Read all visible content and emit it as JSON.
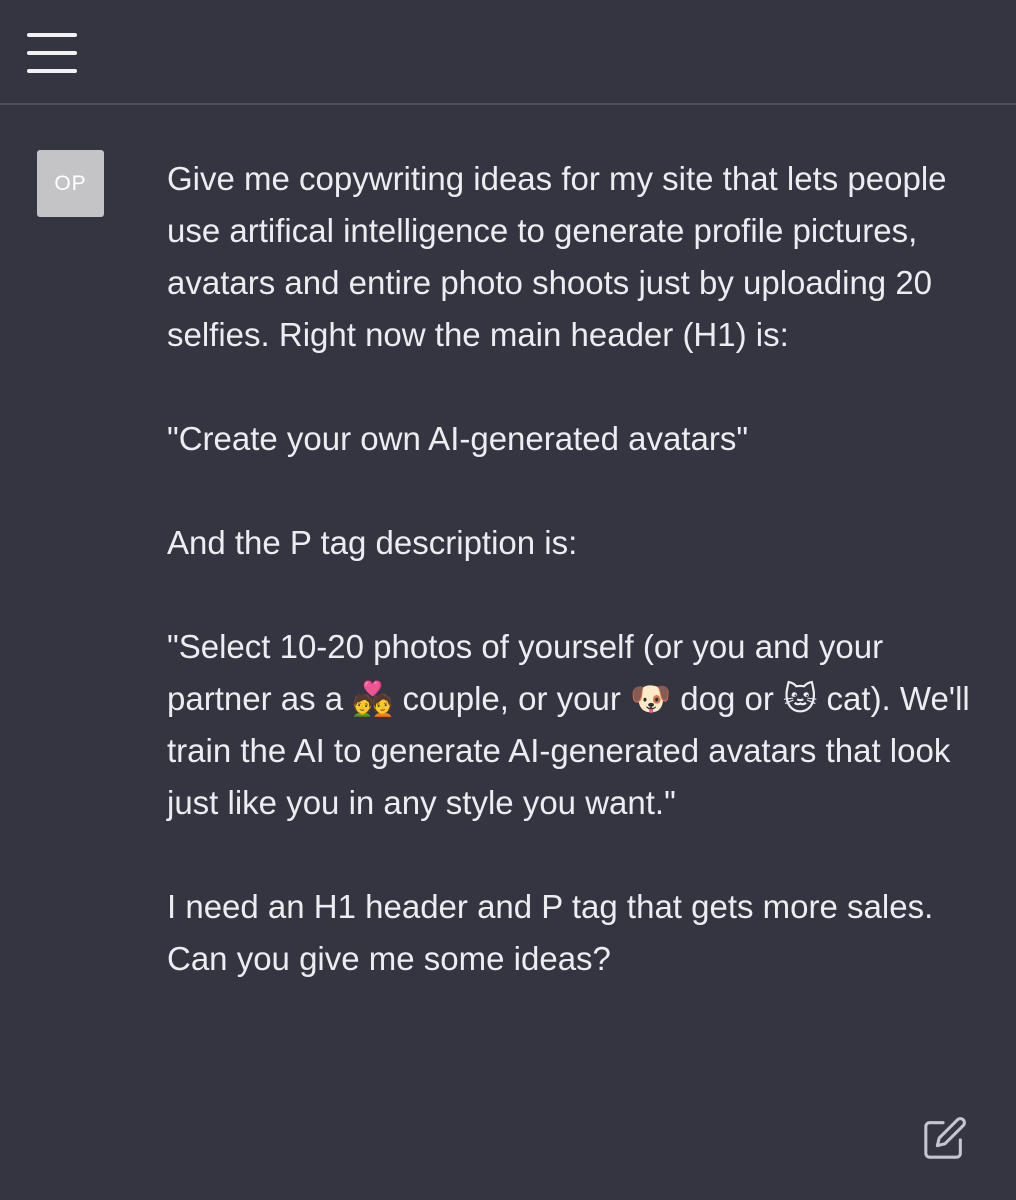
{
  "header": {
    "menu_icon": "hamburger-menu-icon"
  },
  "message": {
    "avatar_initials": "OP",
    "text": "Give me copywriting ideas for my site that lets people use artifical intelligence to generate profile pictures, avatars and entire photo shoots just by uploading 20 selfies. Right now the main header (H1) is:\n\n\"Create your own AI-generated avatars\"\n\nAnd the P tag description is:\n\n\"Select 10-20 photos of yourself (or you and your partner as a 💑 couple, or your 🐶 dog or 🐱 cat). We'll train the AI to generate AI-generated avatars that look just like you in any style you want.\"\n\nI need an H1 header and P tag that gets more sales. Can you give me some ideas?",
    "edit_icon": "edit-icon"
  },
  "colors": {
    "background": "#343541",
    "text": "#ececf1",
    "avatar": "#c4c4c7",
    "icon": "#c5c5d2"
  }
}
